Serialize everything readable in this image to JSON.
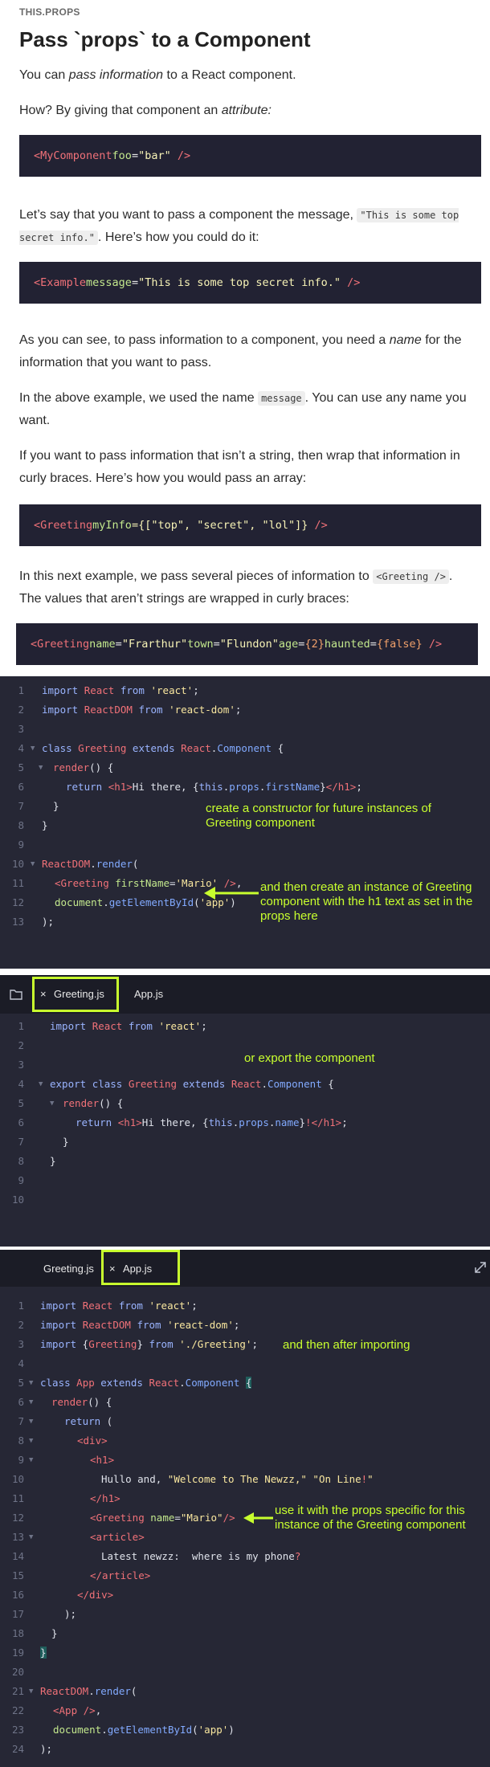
{
  "eyebrow": "THIS.PROPS",
  "title": "Pass `props` to a Component",
  "p1": {
    "a": "You can ",
    "em": "pass information",
    "b": " to a React component."
  },
  "p2": {
    "a": "How? By giving that component an ",
    "em": "attribute:"
  },
  "code1": {
    "tag": "<MyComponent",
    "attr": "foo",
    "val": "\"bar\"",
    "end": " />"
  },
  "p3": {
    "a": "Let’s say that you want to pass a component the message, ",
    "code": "\"This is some top secret info.\"",
    "b": ". Here’s how you could do it:"
  },
  "code2": {
    "tag": "<Example",
    "attr": "message",
    "val": "\"This is some top secret info.\"",
    "end": " />"
  },
  "p4": {
    "a": "As you can see, to pass information to a component, you need a ",
    "em": "name",
    "b": " for the information that you want to pass."
  },
  "p5": {
    "a": "In the above example, we used the name ",
    "code": "message",
    "b": ". You can use any name you want."
  },
  "p6": "If you want to pass information that isn’t a string, then wrap that information in curly braces. Here’s how you would pass an array:",
  "code3": {
    "tag": "<Greeting",
    "attr": "myInfo",
    "val": "={[\"top\", \"secret\", \"lol\"]}",
    "end": " />"
  },
  "p7": {
    "a": "In this next example, we pass several pieces of information to ",
    "code": "<Greeting />",
    "b": ". The values that aren’t strings are wrapped in curly braces:"
  },
  "code4": {
    "tag": "<Greeting",
    "a1": "name",
    "v1": "\"Frarthur\"",
    "a2": "town",
    "v2": "\"Flundon\"",
    "a3": "age",
    "v3": "{2}",
    "a4": "haunted",
    "v4": "{false}",
    "end": " />"
  },
  "editor1": {
    "lines": [
      "1",
      "2",
      "3",
      "4",
      "5",
      "6",
      "7",
      "8",
      "9",
      "10",
      "11",
      "12",
      "13"
    ],
    "note1": "create a constructor for future instances of Greeting component",
    "note2": "and then create an instance of Greeting component with the h1 text as set in the props here"
  },
  "editor2": {
    "tabs": [
      "Greeting.js",
      "App.js"
    ],
    "close_glyph": "×",
    "lines": [
      "1",
      "2",
      "3",
      "4",
      "5",
      "6",
      "7",
      "8",
      "9",
      "10"
    ],
    "note": "or export the component"
  },
  "editor3": {
    "tabs": [
      "Greeting.js",
      "App.js"
    ],
    "close_glyph": "×",
    "lines": [
      "1",
      "2",
      "3",
      "4",
      "5",
      "6",
      "7",
      "8",
      "9",
      "10",
      "11",
      "12",
      "13",
      "14",
      "15",
      "16",
      "17",
      "18",
      "19",
      "20",
      "21",
      "22",
      "23",
      "24"
    ],
    "note1": "and then after importing",
    "note2": "use it with the props specific for this instance of the Greeting component"
  },
  "colors": {
    "annotation": "#c8ff2e",
    "editor_bg": "#262735",
    "codebox_bg": "#222233"
  },
  "icons": [
    "folder-icon",
    "close-tab-icon",
    "expand-icon",
    "arrow-left-icon"
  ]
}
